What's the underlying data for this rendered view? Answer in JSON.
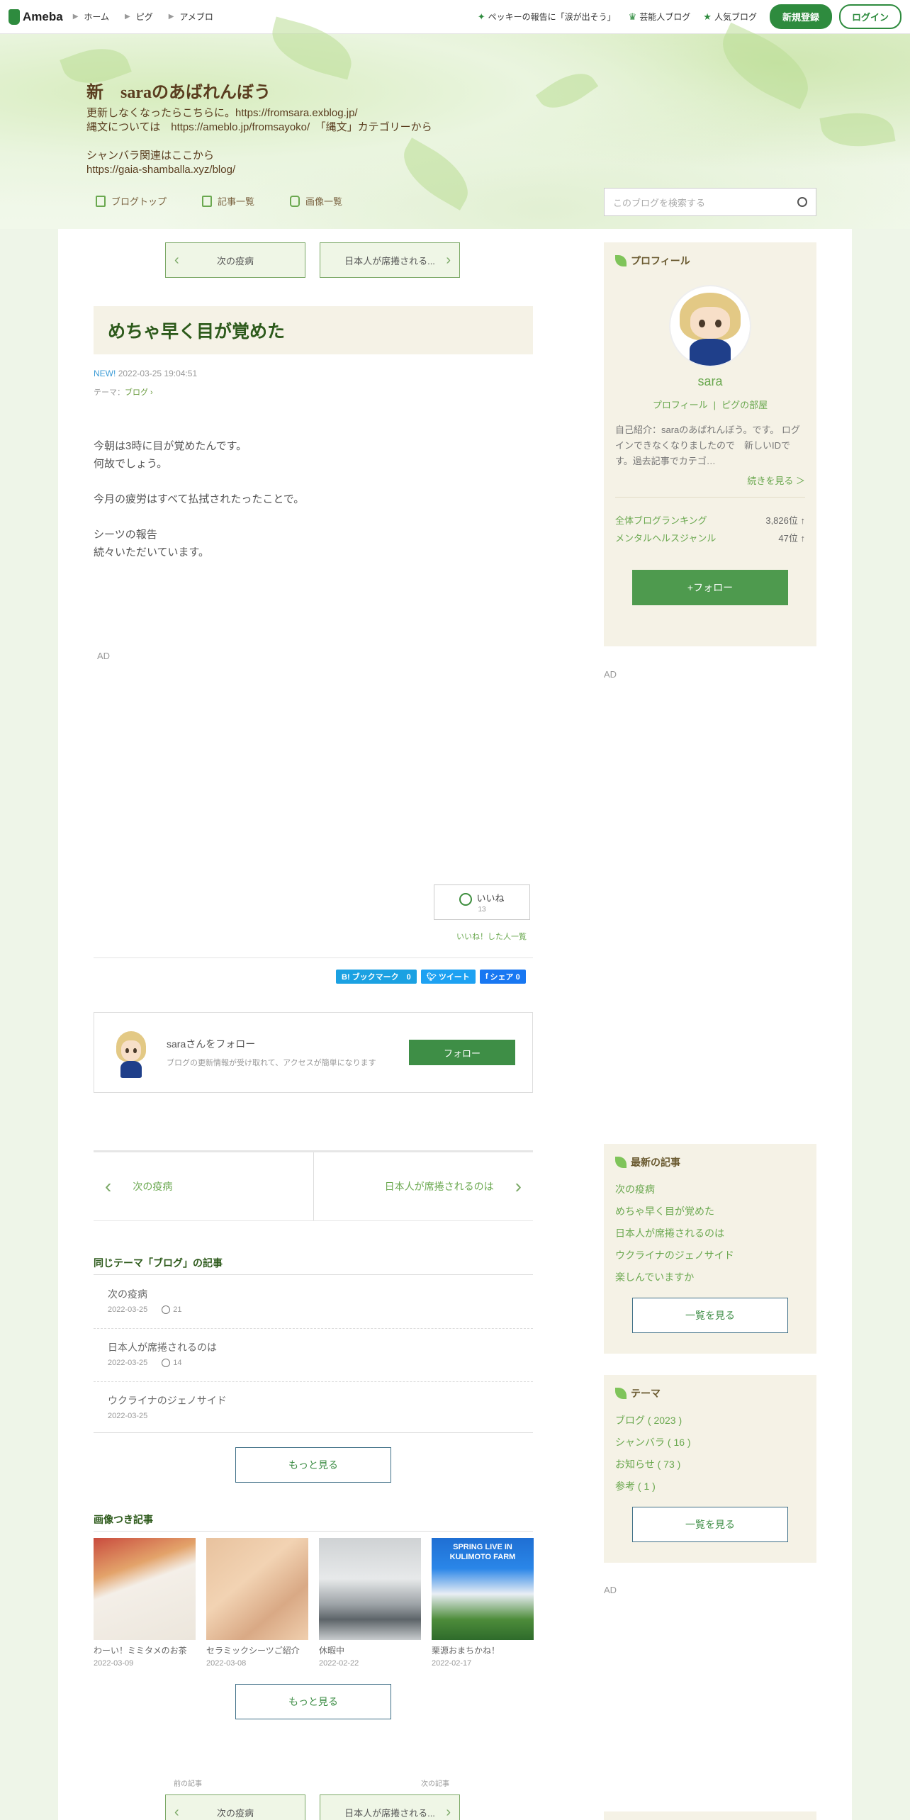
{
  "topbar": {
    "logo": "Ameba",
    "crumbs": [
      "ホーム",
      "ピグ",
      "アメブロ"
    ],
    "links": [
      "ペッキーの報告に「涙が出そう」",
      "芸能人ブログ",
      "人気ブログ"
    ],
    "register": "新規登録",
    "login": "ログイン"
  },
  "blog": {
    "title": "新　saraのあばれんぼう",
    "description": "更新しなくなったらこちらに。https://fromsara.exblog.jp/\n縄文については　https://ameblo.jp/fromsayoko/　「縄文」カテゴリーから\n\nシャンバラ関連はここから\nhttps://gaia-shamballa.xyz/blog/",
    "nav": [
      "ブログトップ",
      "記事一覧",
      "画像一覧"
    ],
    "search_placeholder": "このブログを検索する"
  },
  "pager_top": {
    "prev": "次の疫病",
    "next": "日本人が席捲される..."
  },
  "article": {
    "title": "めちゃ早く目が覚めた",
    "new_label": "NEW!",
    "datetime": "2022-03-25 19:04:51",
    "theme_label": "テーマ：",
    "theme_value": "ブログ",
    "body": "今朝は3時に目が覚めたんです。\n何故でしょう。\n\n今月の疲労はすべて払拭されたったことで。\n\nシーツの報告\n続々いただいています。"
  },
  "ad_label": "AD",
  "like": {
    "label": "いいね",
    "count": "13",
    "list_link": "いいね！した人一覧"
  },
  "share": {
    "hatena": "B! ブックマーク　0",
    "tweet": "ツイート",
    "facebook": "シェア 0"
  },
  "follow_box": {
    "name": "saraさんをフォロー",
    "desc": "ブログの更新情報が受け取れて、アクセスが簡単になります",
    "button": "フォロー"
  },
  "pager_bottom": {
    "prev": "次の疫病",
    "next": "日本人が席捲されるのは"
  },
  "same_theme": {
    "title": "同じテーマ「ブログ」の記事",
    "items": [
      {
        "title": "次の疫病",
        "date": "2022-03-25",
        "likes": "21"
      },
      {
        "title": "日本人が席捲されるのは",
        "date": "2022-03-25",
        "likes": "14"
      },
      {
        "title": "ウクライナのジェノサイド",
        "date": "2022-03-25",
        "likes": ""
      }
    ],
    "more": "もっと見る"
  },
  "image_articles": {
    "title": "画像つき記事",
    "items": [
      {
        "title": "わーい！ミミタメのお茶",
        "date": "2022-03-09"
      },
      {
        "title": "セラミックシーツご紹介",
        "date": "2022-03-08"
      },
      {
        "title": "休暇中",
        "date": "2022-02-22"
      },
      {
        "title": "栗源おまちかね！",
        "date": "2022-02-17"
      }
    ],
    "thumb4_text": "SPRING LIVE IN KULIMOTO FARM",
    "more": "もっと見る"
  },
  "pager_footer": {
    "prev_label": "前の記事",
    "next_label": "次の記事",
    "prev": "次の疫病",
    "next": "日本人が席捲される..."
  },
  "sidebar": {
    "profile": {
      "heading": "プロフィール",
      "name": "sara",
      "links": [
        "プロフィール",
        "ピグの部屋"
      ],
      "intro": "自己紹介：saraのあばれんぼう。です。 ログインできなくなりましたので　新しいIDです。過去記事でカテゴ…",
      "more": "続きを見る ＞",
      "rankings": [
        {
          "label": "全体ブログランキング",
          "value": "3,826位 ↑"
        },
        {
          "label": "メンタルヘルスジャンル",
          "value": "47位 ↑"
        }
      ],
      "follow": "+フォロー"
    },
    "recent": {
      "heading": "最新の記事",
      "items": [
        "次の疫病",
        "めちゃ早く目が覚めた",
        "日本人が席捲されるのは",
        "ウクライナのジェノサイド",
        "楽しんでいますか"
      ],
      "more": "一覧を見る"
    },
    "themes": {
      "heading": "テーマ",
      "items": [
        "ブログ ( 2023 )",
        "シャンバラ ( 16 )",
        "お知らせ ( 73 )",
        "参考 ( 1 )"
      ],
      "more": "一覧を見る"
    }
  },
  "colors": {
    "accent": "#2e8b3e",
    "link": "#6aa84f",
    "title": "#2d5a1b"
  }
}
